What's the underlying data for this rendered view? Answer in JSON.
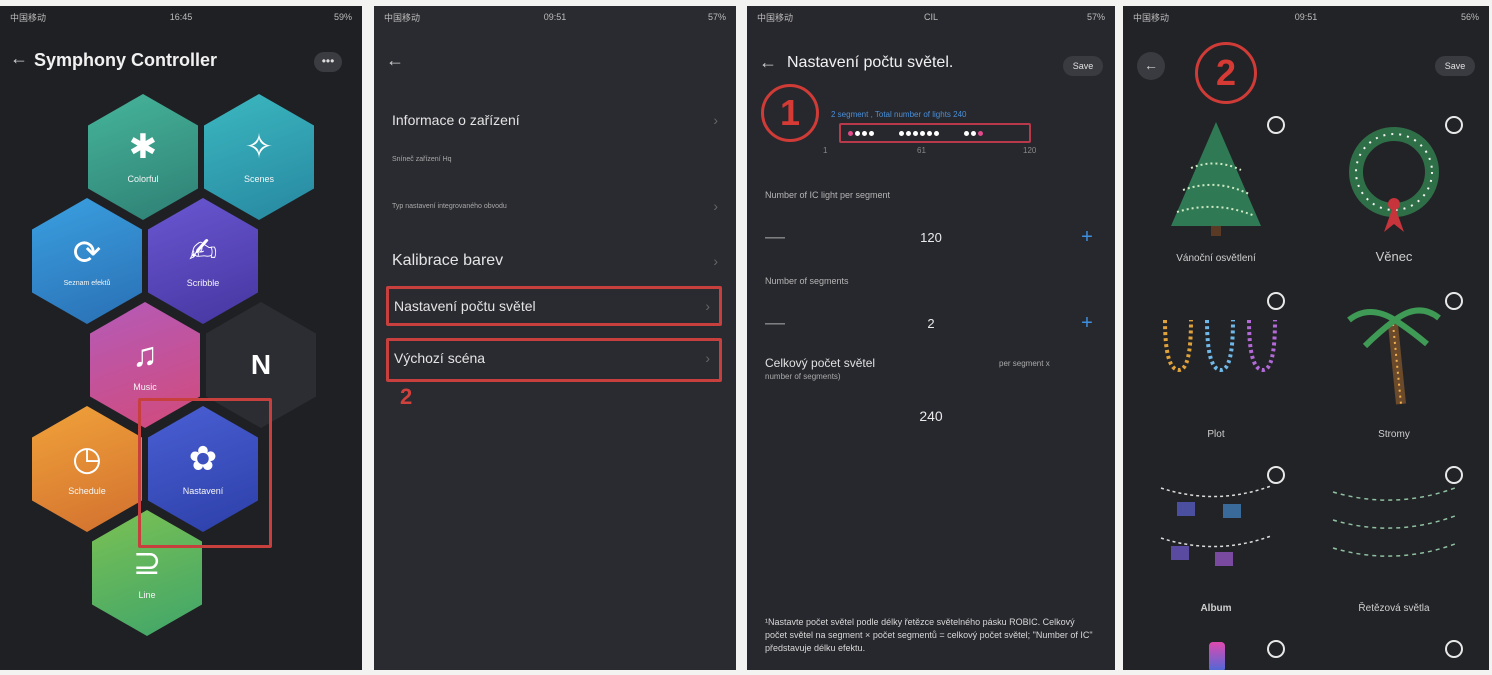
{
  "panel1": {
    "title": "Symphony Controller",
    "more": "•••",
    "hexes": [
      {
        "id": "colorful",
        "label": "Colorful",
        "glyph": "✱",
        "color": "#3a9a86"
      },
      {
        "id": "scenes",
        "label": "Scenes",
        "glyph": "✧",
        "color": "#2f9fa8"
      },
      {
        "id": "sez",
        "label": "Seznam efektů",
        "glyph": "⟳",
        "color": "#2b86c8"
      },
      {
        "id": "scribble",
        "label": "Scribble",
        "glyph": "✍",
        "color": "#5b4bb8"
      },
      {
        "id": "music",
        "label": "Music",
        "glyph": "♫",
        "color": "#c44a9a"
      },
      {
        "id": "n",
        "label": "",
        "glyph": "N",
        "color": "#2d2e33"
      },
      {
        "id": "schedule",
        "label": "Schedule",
        "glyph": "◷",
        "color": "#e48d3a"
      },
      {
        "id": "nastaveni",
        "label": "Nastavení",
        "glyph": "✿",
        "color": "#3d52c4"
      },
      {
        "id": "line",
        "label": "Line",
        "glyph": "⊇",
        "color": "#8bbf4a"
      }
    ]
  },
  "panel2": {
    "items": [
      {
        "label": "Informace o zařízení"
      },
      {
        "label": "Sníneč zařízení",
        "value": "Hq"
      },
      {
        "label": "Typ nastavení integrovaného obvodu"
      },
      {
        "label": "Kalibrace barev"
      },
      {
        "label": "Nastavení počtu světel"
      },
      {
        "label": "Výchozí scéna"
      }
    ],
    "marker": "2"
  },
  "panel3": {
    "status_center": "CIL",
    "title": "Nastavení počtu světel.",
    "save": "Save",
    "marker": "1",
    "segment_info": "2 segment , Total number of lights 240",
    "scale": [
      "1",
      "61",
      "120"
    ],
    "label_ic": "Number of IC light per segment",
    "ic_value": "120",
    "label_segments": "Number of segments",
    "segments_value": "2",
    "total_label": "Celkový počet světel",
    "total_label_right": "per segment x",
    "total_label_sub": "number of segments)",
    "total_value": "240",
    "minus": "—",
    "plus": "+",
    "footnote": "¹Nastavte počet světel podle délky řetězce světelného pásku ROBIC. Celkový počet světel na segment × počet segmentů = celkový počet světel; \"Number of IC\" představuje délku efektu."
  },
  "panel4": {
    "save": "Save",
    "marker": "2",
    "tiles": [
      {
        "label": "Vánoční osvětlení"
      },
      {
        "label": "Věnec"
      },
      {
        "label": "Plot"
      },
      {
        "label": "Stromy"
      },
      {
        "label": "Album"
      },
      {
        "label": "Řetězová světla"
      }
    ]
  },
  "statusbar": {
    "p1_time": "16:45",
    "p2_time": "09:51",
    "p4_time": "09:51",
    "carrier": "中国移动",
    "p1_battery": "59%",
    "p2_battery": "57%",
    "p3_battery": "57%",
    "p4_battery": "56%"
  }
}
